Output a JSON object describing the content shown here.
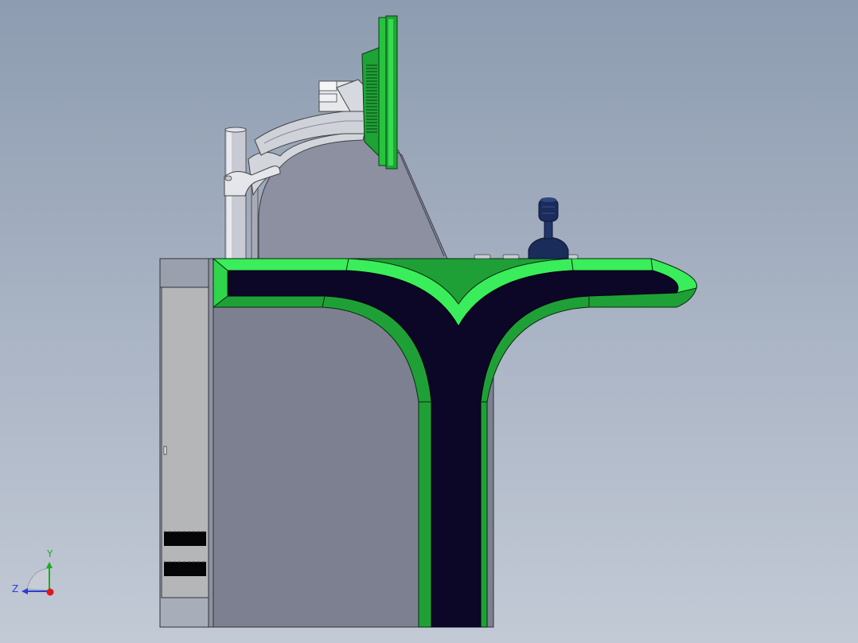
{
  "viewport": {
    "background_top": "#8d9cb0",
    "background_bottom": "#c3cad6"
  },
  "model": {
    "colors": {
      "trim_green": "#23c43b",
      "trim_green_light": "#3aed5a",
      "panel_dark": "#0c0727",
      "cabinet_side": "#7c8090",
      "cabinet_door": "#b5b6b8",
      "rack_body": "#8c90a0",
      "arm_silver": "#c8cbd3",
      "joystick_navy": "#1a2c5a"
    }
  },
  "triad": {
    "y_label": "Y",
    "z_label": "Z",
    "colors": {
      "y": "#18b018",
      "z": "#2a3cd8",
      "x": "#e01818"
    }
  }
}
